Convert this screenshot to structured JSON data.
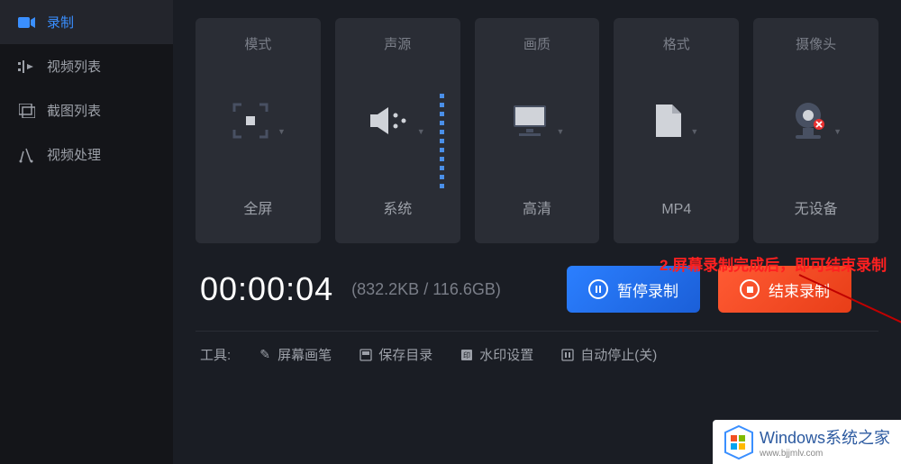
{
  "sidebar": {
    "items": [
      {
        "label": "录制"
      },
      {
        "label": "视频列表"
      },
      {
        "label": "截图列表"
      },
      {
        "label": "视频处理"
      }
    ]
  },
  "cards": {
    "mode": {
      "title": "模式",
      "value": "全屏"
    },
    "audio": {
      "title": "声源",
      "value": "系统"
    },
    "quality": {
      "title": "画质",
      "value": "高清"
    },
    "format": {
      "title": "格式",
      "value": "MP4"
    },
    "camera": {
      "title": "摄像头",
      "value": "无设备"
    }
  },
  "timer": {
    "value": "00:00:04",
    "size": "(832.2KB / 116.6GB)"
  },
  "buttons": {
    "pause": "暂停录制",
    "stop": "结束录制"
  },
  "toolbar": {
    "label": "工具:",
    "pen": "屏幕画笔",
    "save_dir": "保存目录",
    "watermark": "水印设置",
    "auto_stop": "自动停止(关)"
  },
  "annotation": {
    "text": "2.屏幕录制完成后，即可结束录制"
  },
  "watermark": {
    "title": "Windows系统之家",
    "url": "www.bjjmlv.com"
  }
}
